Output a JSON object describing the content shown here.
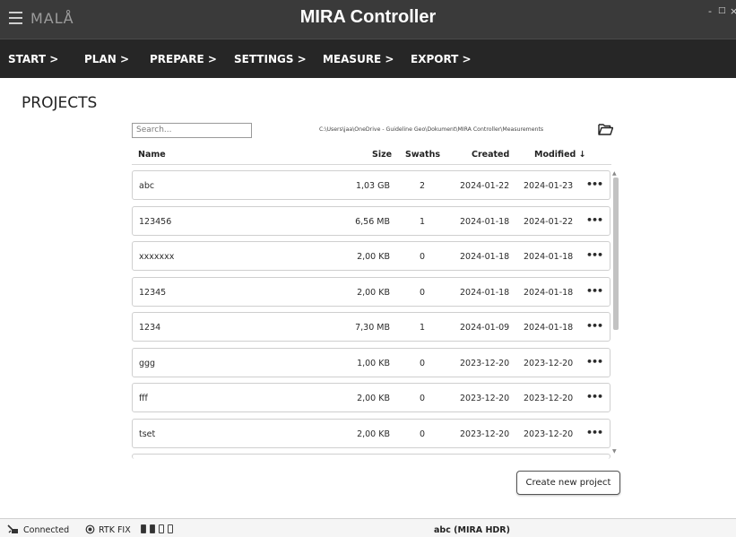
{
  "app": {
    "logo": "MALÅ",
    "title": "MIRA Controller",
    "window_controls": [
      "-",
      "□",
      "×"
    ]
  },
  "nav": {
    "items": [
      "START >",
      "PLAN >",
      "PREPARE >",
      "SETTINGS >",
      "MEASURE >",
      "EXPORT >"
    ]
  },
  "page": {
    "title": "PROJECTS"
  },
  "search": {
    "placeholder": "Search..."
  },
  "path": {
    "text": "C:\\Users\\jaa\\OneDrive - Guideline Geo\\Dokument\\MIRA Controller\\Measurements"
  },
  "table": {
    "columns": {
      "name": "Name",
      "size": "Size",
      "swaths": "Swaths",
      "created": "Created",
      "modified": "Modified ↓"
    },
    "rows": [
      {
        "name": "abc",
        "size": "1,03 GB",
        "swaths": "2",
        "created": "2024-01-22",
        "modified": "2024-01-23",
        "more": "•••"
      },
      {
        "name": "123456",
        "size": "6,56 MB",
        "swaths": "1",
        "created": "2024-01-18",
        "modified": "2024-01-22",
        "more": "•••"
      },
      {
        "name": "xxxxxxx",
        "size": "2,00 KB",
        "swaths": "0",
        "created": "2024-01-18",
        "modified": "2024-01-18",
        "more": "•••"
      },
      {
        "name": "12345",
        "size": "2,00 KB",
        "swaths": "0",
        "created": "2024-01-18",
        "modified": "2024-01-18",
        "more": "•••"
      },
      {
        "name": "1234",
        "size": "7,30 MB",
        "swaths": "1",
        "created": "2024-01-09",
        "modified": "2024-01-18",
        "more": "•••"
      },
      {
        "name": "ggg",
        "size": "1,00 KB",
        "swaths": "0",
        "created": "2023-12-20",
        "modified": "2023-12-20",
        "more": "•••"
      },
      {
        "name": "fff",
        "size": "2,00 KB",
        "swaths": "0",
        "created": "2023-12-20",
        "modified": "2023-12-20",
        "more": "•••"
      },
      {
        "name": "tset",
        "size": "2,00 KB",
        "swaths": "0",
        "created": "2023-12-20",
        "modified": "2023-12-20",
        "more": "•••"
      }
    ]
  },
  "actions": {
    "create_project": "Create new project"
  },
  "status": {
    "connection": "Connected",
    "rtk": "RTK FIX",
    "device": "abc (MIRA HDR)",
    "battery_levels": [
      1,
      1,
      0,
      0
    ]
  },
  "colors": {
    "titlebar": "#3a3a3a",
    "navbar": "#262626",
    "accent": "#ffffff"
  }
}
